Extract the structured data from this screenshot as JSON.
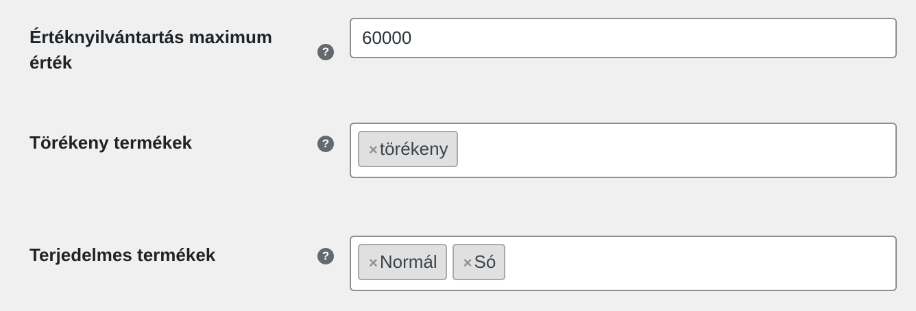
{
  "settings": {
    "max_value": {
      "label": "Értéknyilvántartás maximum érték",
      "help_icon": "?",
      "value": "60000"
    },
    "fragile": {
      "label": "Törékeny termékek",
      "help_icon": "?",
      "tags": [
        {
          "remove": "×",
          "text": "törékeny"
        }
      ]
    },
    "bulky": {
      "label": "Terjedelmes termékek",
      "help_icon": "?",
      "tags": [
        {
          "remove": "×",
          "text": "Normál"
        },
        {
          "remove": "×",
          "text": "Só"
        }
      ]
    }
  },
  "colors": {
    "background": "#f0f0f1",
    "input_border": "#8c8f94",
    "tag_background": "#e0e0e0",
    "help_icon": "#646970"
  }
}
